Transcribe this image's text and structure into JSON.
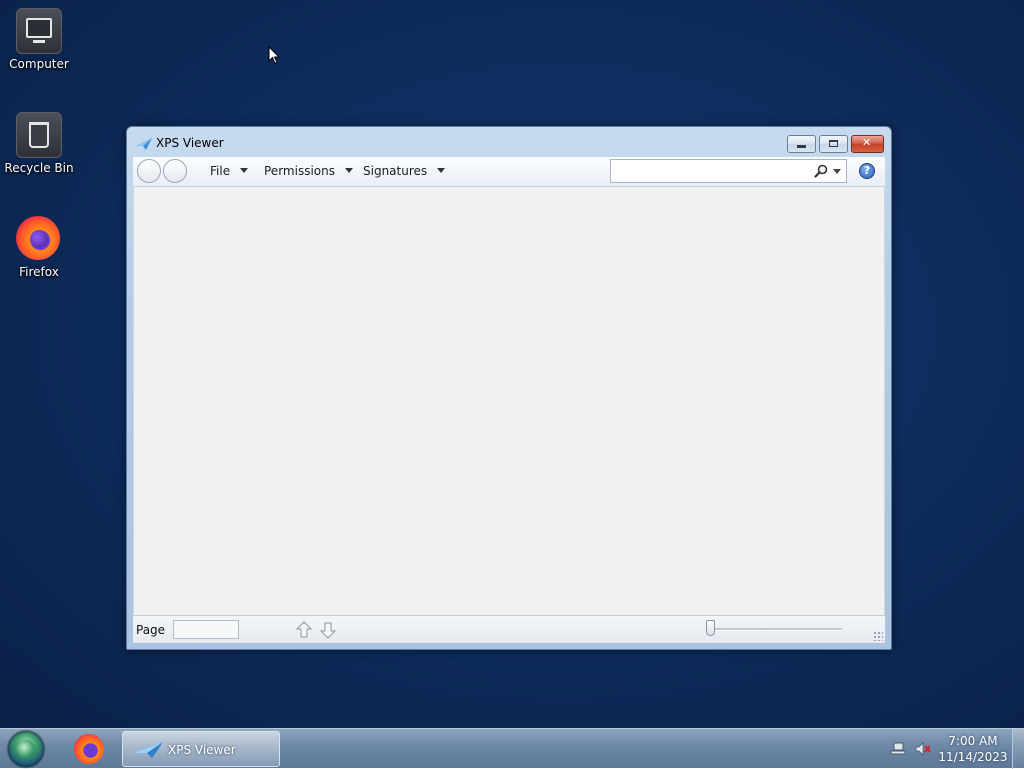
{
  "desktop": {
    "icons": [
      {
        "label": "Computer"
      },
      {
        "label": "Recycle Bin"
      },
      {
        "label": "Firefox"
      }
    ]
  },
  "window": {
    "title": "XPS Viewer",
    "menus": {
      "file": "File",
      "permissions": "Permissions",
      "signatures": "Signatures"
    },
    "search": {
      "value": "",
      "placeholder": ""
    },
    "help_glyph": "?",
    "status": {
      "page_label": "Page",
      "page_value": "",
      "zoom_fraction": 0
    }
  },
  "taskbar": {
    "pinned": [
      "firefox-icon"
    ],
    "active_window_label": "XPS Viewer",
    "clock": {
      "time": "7:00 AM",
      "date": "11/14/2023"
    }
  },
  "colors": {
    "desktop_bg": "#0f2d5e",
    "window_frame": "#b4cde8",
    "content_bg": "#f1f1f1",
    "close_button": "#c33f2a"
  }
}
